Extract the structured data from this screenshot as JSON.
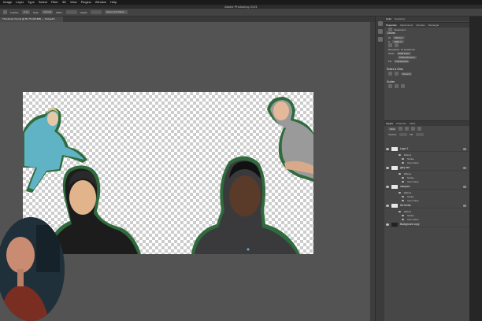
{
  "menu": [
    "Image",
    "Layer",
    "Type",
    "Select",
    "Filter",
    "3D",
    "View",
    "Plugins",
    "Window",
    "Help"
  ],
  "app_title": "Adobe Photoshop 2021",
  "options": {
    "feather_label": "Feather:",
    "feather_value": "0 px",
    "style_label": "Style:",
    "style_value": "Normal",
    "width_label": "Width:",
    "height_label": "Height:",
    "select_mask": "Select and Mask..."
  },
  "document_tab": "Thumbnail V2.psd @ 66.7% (RGB/8) — Stroke/Fx",
  "properties": {
    "tabs": [
      "Properties",
      "Adjustments",
      "Libraries",
      "Rectangle"
    ],
    "document_label": "Document",
    "canvas_title": "Canvas",
    "width": "1920 px",
    "height": "1080 px",
    "resolution": "Resolution: 72 pixels/inch",
    "mode_label": "Mode",
    "mode_value": "RGB Color",
    "depth_value": "8 Bits/Channel",
    "fill_label": "Fill",
    "fill_value": "Transparent",
    "rulers_title": "Rulers & Grids",
    "rulers_value": "Percent",
    "guides_title": "Guides"
  },
  "color_tabs": [
    "Color",
    "Swatches"
  ],
  "layers": {
    "tabs": [
      "Layers",
      "Channels",
      "Paths"
    ],
    "kind_label": "Kind",
    "opacity_label": "Opacity:",
    "fill_label": "Fill:",
    "items": [
      {
        "name": "Layer 1",
        "subs": [
          "Effects",
          "Stroke",
          "Inner Glow"
        ]
      },
      {
        "name": "gary vee",
        "subs": [
          "Effects",
          "Stroke",
          "Inner Glow"
        ]
      },
      {
        "name": "marques",
        "subs": [
          "Effects",
          "Stroke",
          "Inner Glow"
        ]
      },
      {
        "name": "tim ferriss",
        "subs": [
          "Effects",
          "Stroke",
          "Inner Glow"
        ]
      }
    ],
    "background": "Background copy"
  },
  "colors": {
    "stroke": "#2f6b3c",
    "checker_light": "#ffffff",
    "checker_dark": "#cccccc",
    "workspace": "#535353",
    "panel": "#474747"
  }
}
